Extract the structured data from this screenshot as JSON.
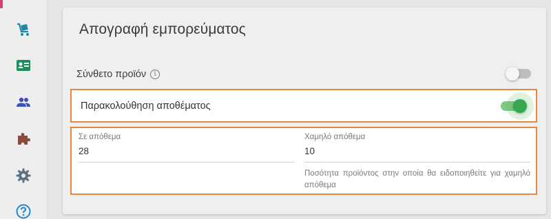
{
  "sidebar": {
    "accent_color": "#d63f6f",
    "items": [
      {
        "icon": "cart-icon",
        "color": "#1e88a8"
      },
      {
        "icon": "id-card-icon",
        "color": "#1a8f5a"
      },
      {
        "icon": "users-icon",
        "color": "#3f51b5"
      },
      {
        "icon": "puzzle-icon",
        "color": "#8d4a3a"
      },
      {
        "icon": "gear-icon",
        "color": "#607080"
      },
      {
        "icon": "help-icon",
        "color": "#1e88d8"
      }
    ]
  },
  "card": {
    "title": "Απογραφή εμπορεύματος",
    "composite": {
      "label": "Σύνθετο προϊόν",
      "info_glyph": "i",
      "enabled": false
    },
    "tracking": {
      "label": "Παρακολούθηση αποθέματος",
      "enabled": true
    },
    "in_stock": {
      "label": "Σε απόθεμα",
      "value": "28"
    },
    "low_stock": {
      "label": "Χαμηλό απόθεμα",
      "value": "10",
      "hint": "Ποσότητα προϊόντος στην οποία θα ειδοποιηθείτε για χαμηλό απόθεμα"
    }
  },
  "colors": {
    "highlight_border": "#e8873c",
    "toggle_on": "#34a853"
  }
}
